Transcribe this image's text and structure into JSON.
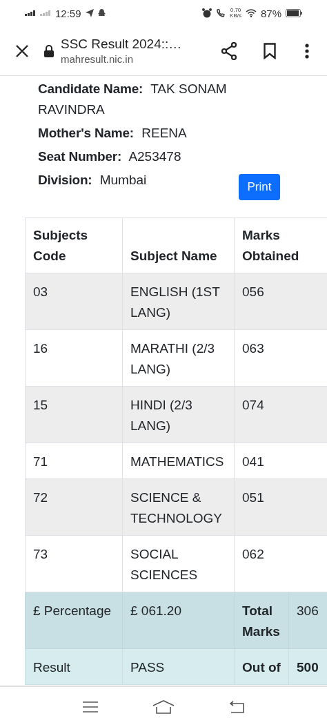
{
  "status_bar": {
    "time": "12:59",
    "net_speed": "0.70",
    "net_unit": "KB/s",
    "battery": "87%"
  },
  "browser": {
    "title": "SSC Result 2024::…",
    "url": "mahresult.nic.in"
  },
  "candidate": [
    {
      "label": "Candidate Name:",
      "value": "TAK SONAM RAVINDRA"
    },
    {
      "label": "Mother's Name:",
      "value": "REENA"
    },
    {
      "label": "Seat Number:",
      "value": "A253478"
    },
    {
      "label": "Division:",
      "value": "Mumbai"
    }
  ],
  "print_button": "Print",
  "table": {
    "columns": [
      "Subjects Code",
      "Subject Name",
      "Marks Obtained"
    ],
    "rows": [
      {
        "code": "03",
        "name": "ENGLISH (1ST LANG)",
        "marks": "056"
      },
      {
        "code": "16",
        "name": "MARATHI (2/3 LANG)",
        "marks": "063"
      },
      {
        "code": "15",
        "name": "HINDI (2/3 LANG)",
        "marks": "074"
      },
      {
        "code": "71",
        "name": "MATHEMATICS",
        "marks": "041"
      },
      {
        "code": "72",
        "name": "SCIENCE & TECHNOLOGY",
        "marks": "051"
      },
      {
        "code": "73",
        "name": "SOCIAL SCIENCES",
        "marks": "062"
      }
    ],
    "summary": [
      {
        "label": "£ Percentage",
        "value": "£ 061.20",
        "stat_label": "Total Marks",
        "stat_value": "306",
        "stat_value_bold": false
      },
      {
        "label": "Result",
        "value": "PASS",
        "stat_label": "Out of",
        "stat_value": "500",
        "stat_value_bold": true
      }
    ]
  }
}
